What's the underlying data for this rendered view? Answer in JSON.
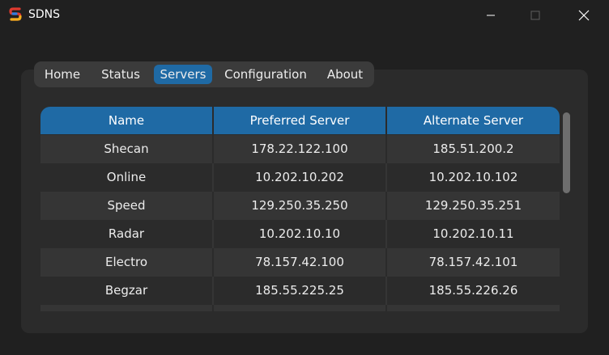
{
  "window": {
    "title": "SDNS"
  },
  "tabs": [
    {
      "label": "Home",
      "active": false
    },
    {
      "label": "Status",
      "active": false
    },
    {
      "label": "Servers",
      "active": true
    },
    {
      "label": "Configuration",
      "active": false
    },
    {
      "label": "About",
      "active": false
    }
  ],
  "table": {
    "headers": [
      "Name",
      "Preferred Server",
      "Alternate Server"
    ],
    "rows": [
      [
        "Shecan",
        "178.22.122.100",
        "185.51.200.2"
      ],
      [
        "Online",
        "10.202.10.202",
        "10.202.10.102"
      ],
      [
        "Speed",
        "129.250.35.250",
        "129.250.35.251"
      ],
      [
        "Radar",
        "10.202.10.10",
        "10.202.10.11"
      ],
      [
        "Electro",
        "78.157.42.100",
        "78.157.42.101"
      ],
      [
        "Begzar",
        "185.55.225.25",
        "185.55.226.26"
      ]
    ]
  },
  "colors": {
    "accent": "#1f6aa5",
    "background": "#202020",
    "panel": "#2b2b2b",
    "row_alt": "#353535"
  },
  "icons": {
    "app": "sdns-logo-icon",
    "minimize": "minimize-icon",
    "maximize": "maximize-icon",
    "close": "close-icon"
  }
}
